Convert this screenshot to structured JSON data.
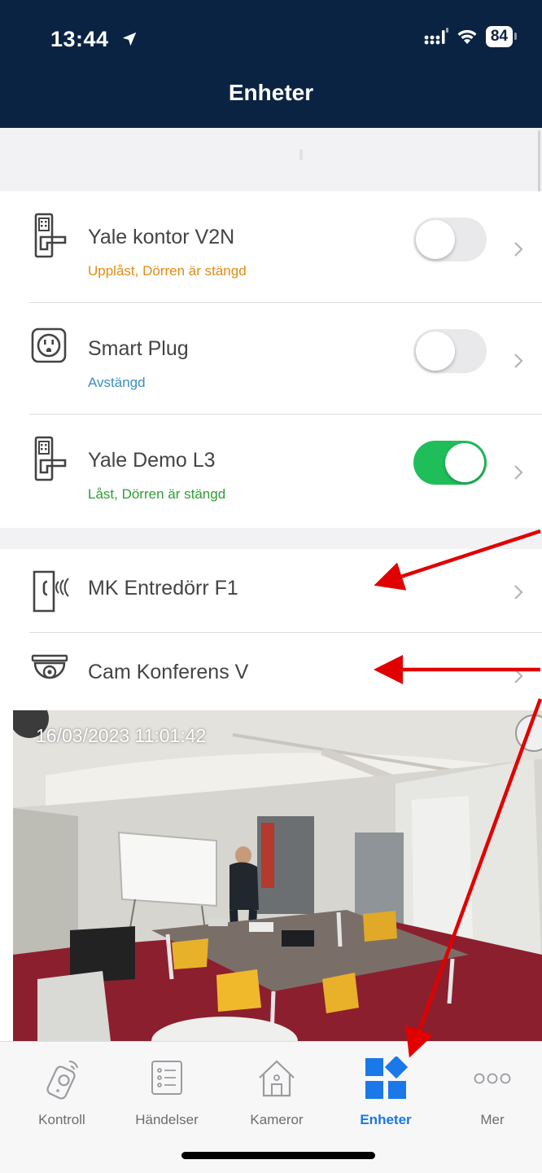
{
  "status_bar": {
    "time": "13:44",
    "battery": "84"
  },
  "header": {
    "title": "Enheter"
  },
  "devices": [
    {
      "name": "Yale kontor V2N",
      "status": "Upplåst, Dörren är stängd",
      "toggle_on": false
    },
    {
      "name": "Smart Plug",
      "status": "Avstängd",
      "toggle_on": false
    },
    {
      "name": "Yale Demo L3",
      "status": "Låst, Dörren är stängd",
      "toggle_on": true
    }
  ],
  "other_devices": [
    {
      "name": "MK Entredörr F1"
    },
    {
      "name": "Cam Konferens V"
    }
  ],
  "camera": {
    "timestamp": "16/03/2023 11:01:42"
  },
  "tabs": [
    {
      "label": "Kontroll",
      "icon": "remote-control-icon"
    },
    {
      "label": "Händelser",
      "icon": "event-list-icon"
    },
    {
      "label": "Kameror",
      "icon": "house-icon"
    },
    {
      "label": "Enheter",
      "icon": "devices-grid-icon",
      "active": true
    },
    {
      "label": "Mer",
      "icon": "more-dots-icon"
    }
  ],
  "colors": {
    "header_bg": "#0b2343",
    "accent": "#1a78e8",
    "toggle_on": "#1fbe5a",
    "status_unlocked": "#e38a14",
    "status_off": "#3a8ec7",
    "status_locked": "#2f9c33",
    "annotation_arrow": "#e00000"
  }
}
